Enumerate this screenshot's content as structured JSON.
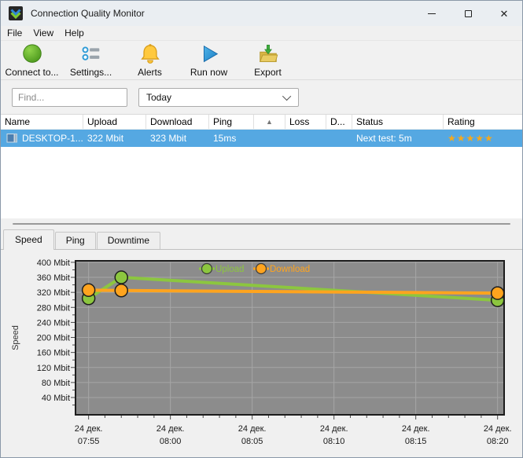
{
  "window": {
    "title": "Connection Quality Monitor",
    "close_glyph": "✕",
    "controls": [
      "minimize",
      "maximize",
      "close"
    ]
  },
  "menu": {
    "items": [
      {
        "label": "File"
      },
      {
        "label": "View"
      },
      {
        "label": "Help"
      }
    ]
  },
  "toolbar": {
    "buttons": [
      {
        "label": "Connect to...",
        "icon": "connect-circle-icon"
      },
      {
        "label": "Settings...",
        "icon": "settings-sliders-icon"
      },
      {
        "label": "Alerts",
        "icon": "bell-icon"
      },
      {
        "label": "Run now",
        "icon": "play-icon"
      },
      {
        "label": "Export",
        "icon": "export-folder-icon"
      }
    ]
  },
  "filters": {
    "find_placeholder": "Find...",
    "period": "Today"
  },
  "table": {
    "sort_indicator": "▲",
    "columns": [
      {
        "label": "Name"
      },
      {
        "label": "Upload"
      },
      {
        "label": "Download"
      },
      {
        "label": "Ping"
      },
      {
        "label": ""
      },
      {
        "label": "Loss"
      },
      {
        "label": "D..."
      },
      {
        "label": "Status"
      },
      {
        "label": "Rating"
      }
    ],
    "row": {
      "name": "DESKTOP-1...",
      "upload": "322 Mbit",
      "download": "323 Mbit",
      "ping": "15ms",
      "loss": "",
      "d": "",
      "status": "Next test: 5m",
      "rating_stars": "★★★★★"
    }
  },
  "tabs": {
    "items": [
      {
        "label": "Speed",
        "active": true
      },
      {
        "label": "Ping",
        "active": false
      },
      {
        "label": "Downtime",
        "active": false
      }
    ]
  },
  "chart_data": {
    "type": "line",
    "title": "",
    "ylabel": "Speed",
    "y_unit": "Mbit",
    "y_ticks": [
      40,
      80,
      120,
      160,
      200,
      240,
      280,
      320,
      360,
      400
    ],
    "ylim": [
      0,
      400
    ],
    "grid": true,
    "plot_bg": "#8c8c8c",
    "grid_color": "#a6a6a6",
    "legend_position": "top-center",
    "x_axis": {
      "date_label": "24 дек.",
      "times": [
        "07:55",
        "08:00",
        "08:05",
        "08:10",
        "08:15",
        "08:20"
      ]
    },
    "series": [
      {
        "name": "Upload",
        "color": "#8CC63F",
        "x_times": [
          "07:55",
          "07:57",
          "08:20"
        ],
        "x_minutes": [
          0,
          2,
          25
        ],
        "values": [
          304,
          360,
          299
        ]
      },
      {
        "name": "Download",
        "color": "#FFA41E",
        "x_times": [
          "07:55",
          "07:57",
          "08:20"
        ],
        "x_minutes": [
          0,
          2,
          25
        ],
        "values": [
          326,
          325,
          318
        ]
      }
    ]
  }
}
